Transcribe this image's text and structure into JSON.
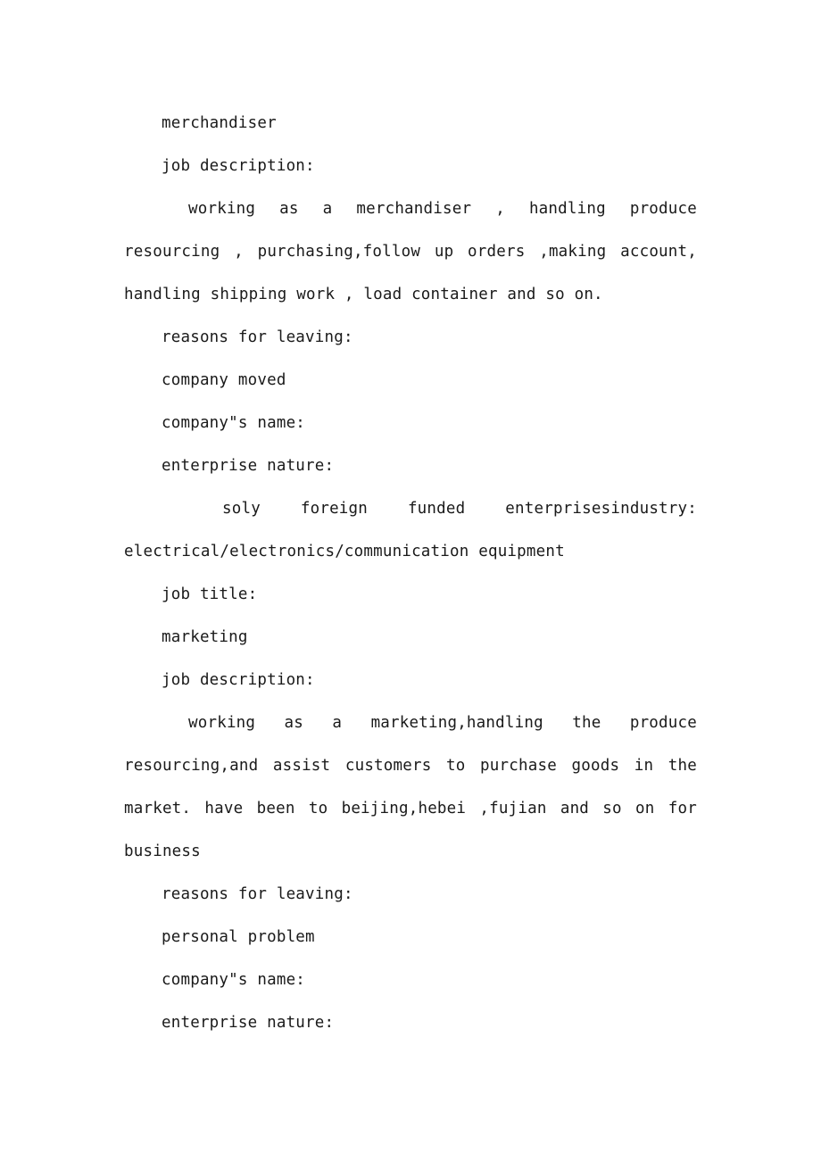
{
  "document": {
    "type": "resume-work-experience-excerpt",
    "background_color": "#ffffff",
    "text_color": "#1a1a1a",
    "blocks": [
      {
        "id": "job_title_value_1",
        "kind": "line",
        "indent": "indent-1",
        "text": "merchandiser"
      },
      {
        "id": "job_description_label_1",
        "kind": "line",
        "indent": "indent-1",
        "text": "job description:"
      },
      {
        "id": "job_description_body_1",
        "kind": "paragraph",
        "indent": "indent-first",
        "text": "working as a merchandiser , handling produce resourcing , purchasing,follow up orders ,making account, handling shipping work , load container and so on."
      },
      {
        "id": "reasons_for_leaving_label_1",
        "kind": "line",
        "indent": "indent-1",
        "text": "reasons for leaving:"
      },
      {
        "id": "reasons_for_leaving_value_1",
        "kind": "line",
        "indent": "indent-1",
        "text": "company moved"
      },
      {
        "id": "company_name_label_1",
        "kind": "line",
        "indent": "indent-1",
        "text": "company\"s name:"
      },
      {
        "id": "enterprise_nature_label_1",
        "kind": "line",
        "indent": "indent-1",
        "text": "enterprise nature:"
      },
      {
        "id": "enterprise_nature_body_1",
        "kind": "paragraph",
        "indent": "indent-deep",
        "text": "soly foreign funded enterprisesindustry: electrical/electronics/communication equipment"
      },
      {
        "id": "job_title_label_2",
        "kind": "line",
        "indent": "indent-1",
        "text": "job title:"
      },
      {
        "id": "job_title_value_2",
        "kind": "line",
        "indent": "indent-1",
        "text": "marketing"
      },
      {
        "id": "job_description_label_2",
        "kind": "line",
        "indent": "indent-1",
        "text": "job description:"
      },
      {
        "id": "job_description_body_2",
        "kind": "paragraph",
        "indent": "indent-first",
        "text": "working as a marketing,handling the produce resourcing,and assist customers to purchase goods in the market. have been to beijing,hebei ,fujian and so on for business"
      },
      {
        "id": "reasons_for_leaving_label_2",
        "kind": "line",
        "indent": "indent-1",
        "text": "reasons for leaving:"
      },
      {
        "id": "reasons_for_leaving_value_2",
        "kind": "line",
        "indent": "indent-1",
        "text": "personal problem"
      },
      {
        "id": "company_name_label_2",
        "kind": "line",
        "indent": "indent-1",
        "text": "company\"s name:"
      },
      {
        "id": "enterprise_nature_label_2",
        "kind": "line",
        "indent": "indent-1",
        "text": "enterprise nature:"
      }
    ]
  }
}
